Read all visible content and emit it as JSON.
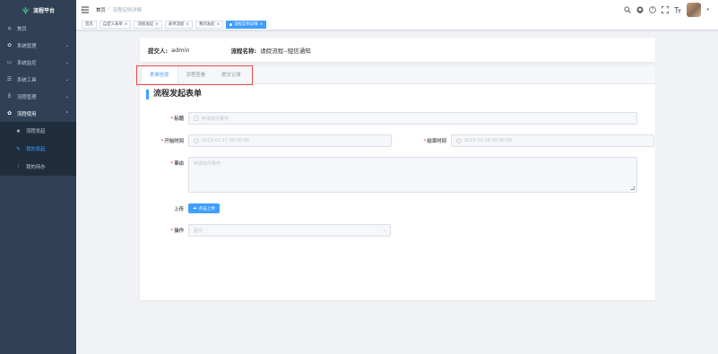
{
  "sidebar": {
    "logo_text": "流程平台",
    "items": [
      {
        "label": "首页",
        "icon": "home-icon"
      },
      {
        "label": "系统管理",
        "icon": "gear-icon"
      },
      {
        "label": "系统监控",
        "icon": "monitor-icon"
      },
      {
        "label": "系统工具",
        "icon": "tool-icon"
      },
      {
        "label": "流程管理",
        "icon": "flow-icon"
      },
      {
        "label": "流程使用",
        "icon": "gear-icon"
      }
    ],
    "subitems": [
      {
        "label": "流程发起",
        "icon": "star-icon"
      },
      {
        "label": "我的发起",
        "icon": "edit-icon"
      },
      {
        "label": "我的待办",
        "icon": "list-icon"
      }
    ]
  },
  "navbar": {
    "breadcrumb": [
      "首页",
      "流程实例详情"
    ]
  },
  "tags": [
    "首页",
    "自定义表单",
    "流程发起",
    "表单流程",
    "我的发起",
    "流程实例详情"
  ],
  "info": {
    "submitter_label": "提交人:",
    "submitter": "admin",
    "flow_name_label": "流程名称:",
    "flow_name": "请假流程--短信通知"
  },
  "tabs": [
    "表单信息",
    "流程查看",
    "提交记录"
  ],
  "form": {
    "title": "流程发起表单",
    "title_label": "标题",
    "title_placeholder": "申请软件著作",
    "start_label": "开始时间",
    "start_value": "2023-02-17 00:00:00",
    "end_label": "结束时间",
    "end_value": "2023-02-18 00:00:00",
    "reason_label": "事由",
    "reason_placeholder": "申请软件著作",
    "upload_label": "上传",
    "upload_button": "点击上传",
    "op_label": "操作",
    "op_value": "提交"
  }
}
